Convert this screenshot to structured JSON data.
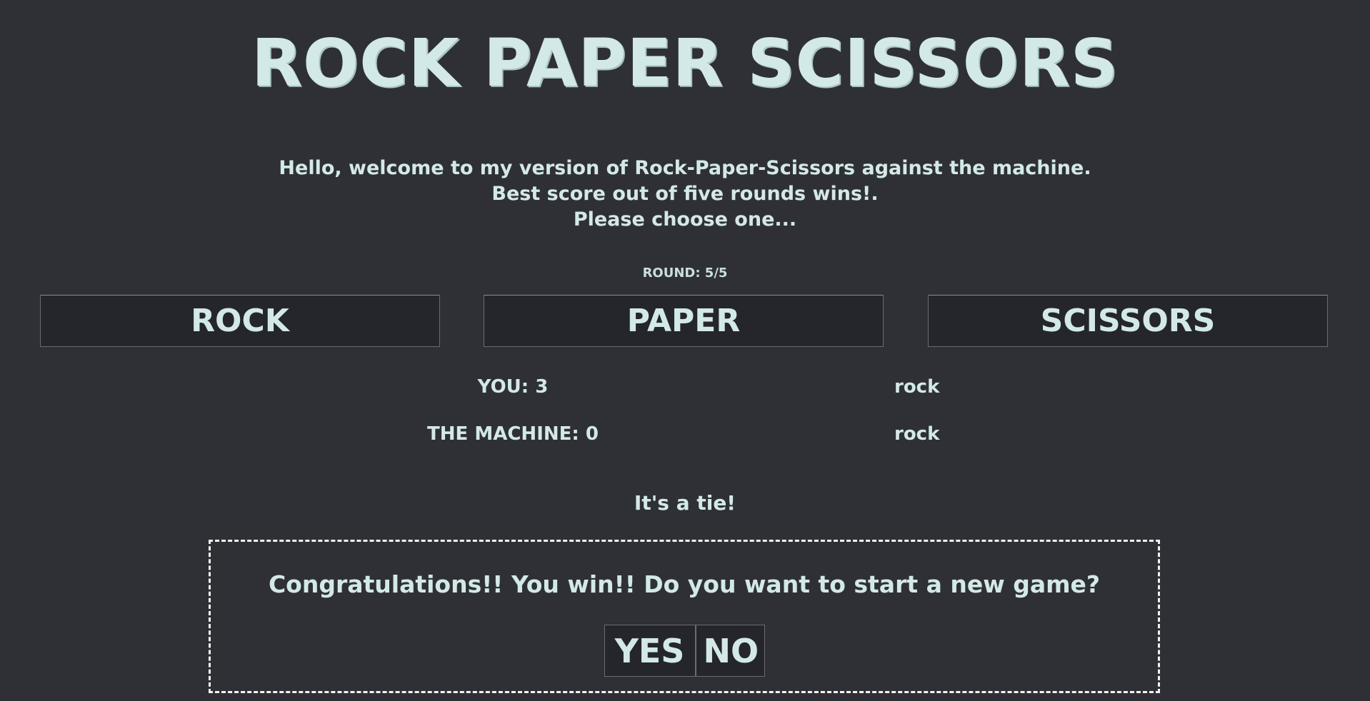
{
  "title": "ROCK PAPER SCISSORS",
  "intro": {
    "line1": "Hello, welcome to my version of Rock-Paper-Scissors against the machine.",
    "line2": "Best score out of five rounds wins!.",
    "line3": "Please choose one..."
  },
  "round": {
    "text": "ROUND: 5/5"
  },
  "choices": {
    "rock": "ROCK",
    "paper": "PAPER",
    "scissors": "SCISSORS"
  },
  "scores": {
    "you": "YOU: 3",
    "machine": "THE MACHINE: 0",
    "you_choice": "rock",
    "machine_choice": "rock"
  },
  "result": "It's a tie!",
  "modal": {
    "message": "Congratulations!! You win!! Do you want to start a new game?",
    "yes": "YES",
    "no": "NO"
  },
  "colors": {
    "background": "#2f3035",
    "text": "#d3e9e7",
    "button_bg": "#25262b",
    "modal_border": "#f2f2f2"
  }
}
